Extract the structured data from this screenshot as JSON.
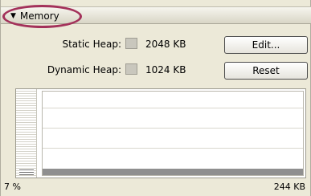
{
  "panel": {
    "title": "Memory",
    "collapse_glyph": "▼"
  },
  "static_heap": {
    "label": "Static Heap:",
    "value": "2048 KB",
    "button": "Edit..."
  },
  "dynamic_heap": {
    "label": "Dynamic Heap:",
    "value": "1024 KB",
    "button": "Reset"
  },
  "usage": {
    "percent_label": "7 %",
    "total_label": "244 KB",
    "percent": 7
  },
  "colors": {
    "highlight_circle": "#a3315a",
    "panel_bg": "#ece9d8"
  }
}
